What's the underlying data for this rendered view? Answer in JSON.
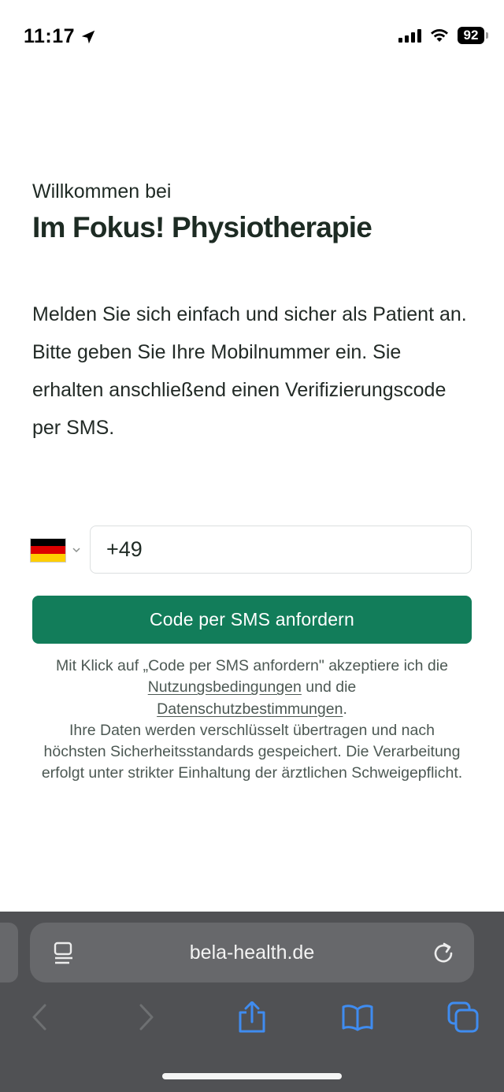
{
  "status_bar": {
    "time": "11:17",
    "battery": "92"
  },
  "content": {
    "welcome": "Willkommen bei",
    "practice_name": "Im Fokus! Physiotherapie",
    "intro_line1": "Melden Sie sich einfach und sicher als Patient an.",
    "intro_line2": "Bitte geben Sie Ihre Mobilnummer ein. Sie erhalten anschließend einen Verifizierungscode per SMS."
  },
  "phone": {
    "country": "Deutschland",
    "value": "+49"
  },
  "actions": {
    "sms_button_label": "Code per SMS anfordern"
  },
  "disclaimer": {
    "part1": "Mit Klick auf „Code per SMS anfordern\" akzeptiere ich die ",
    "terms_link": "Nutzungsbedingungen",
    "part2": " und die ",
    "privacy_link": "Datenschutzbestimmungen",
    "part3": ".",
    "security_text": "Ihre Daten werden verschlüsselt übertragen und nach höchsten Sicherheitsstandards gespeichert. Die Verarbeitung erfolgt unter strikter Einhaltung der ärztlichen Schweigepflicht."
  },
  "browser": {
    "url": "bela-health.de"
  },
  "colors": {
    "accent": "#127d5a",
    "heading": "#1d2b23",
    "browser_bar": "#505154",
    "toolbar_icon_active": "#3f8cf0"
  },
  "icons": [
    "location-arrow-icon",
    "signal-icon",
    "wifi-icon",
    "battery-icon",
    "germany-flag-icon",
    "chevron-down-icon",
    "reader-icon",
    "reload-icon",
    "back-icon",
    "forward-icon",
    "share-icon",
    "bookmarks-icon",
    "tabs-icon"
  ]
}
